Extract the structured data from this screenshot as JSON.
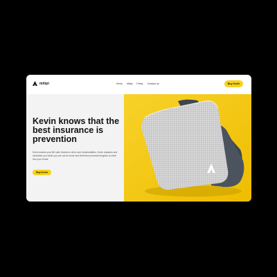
{
  "brand": {
    "name": "mitipi",
    "accent": "#f7d21a",
    "logo_icon": "triangle-a-logo-icon"
  },
  "nav": {
    "links": [
      "Kevin",
      "Mitipi",
      "Press",
      "Contact us"
    ],
    "buy_label": "Buy Kevin"
  },
  "hero": {
    "headline": "Kevin knows that the best insurance is prevention",
    "body": "Kevin makes your life safe, thanks to all-in-one functionalities. Kevin replaces and simulates you while you are not at home and therefore prevents burglars to enter into your home.",
    "cta_label": "Buy Kevin",
    "image_background": "#f6c90e",
    "product_icon": "kevin-device-image"
  }
}
